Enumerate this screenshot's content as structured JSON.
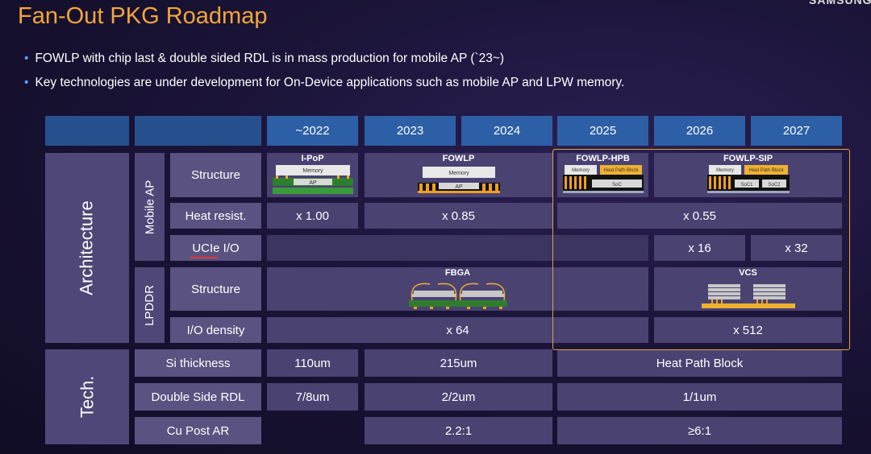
{
  "title": "Fan-Out PKG Roadmap",
  "brand": "SAMSUNG",
  "bullets": [
    "FOWLP with chip last & double sided RDL is in mass production for mobile AP (`23~)",
    "Key technologies are under development for On-Device applications such as mobile AP and LPW memory."
  ],
  "years": [
    "~2022",
    "2023",
    "2024",
    "2025",
    "2026",
    "2027"
  ],
  "groups": {
    "architecture": "Architecture",
    "tech": "Tech.",
    "mobile_ap": "Mobile AP",
    "lpddr": "LPDDR"
  },
  "rows": {
    "structure": "Structure",
    "heat_resist": "Heat resist.",
    "ucie_io": "UCIe I/O",
    "lp_structure": "Structure",
    "io_density": "I/O density",
    "si_thickness": "Si thickness",
    "double_side_rdl": "Double Side RDL",
    "cu_post_ar": "Cu Post AR"
  },
  "packages": {
    "ipop": {
      "name": "I-PoP",
      "top": "Memory",
      "chip": "AP"
    },
    "fowlp": {
      "name": "FOWLP",
      "top": "Memory",
      "chip": "AP"
    },
    "fowlp_hpb": {
      "name": "FOWLP-HPB",
      "top": "Memory",
      "block": "Heat Path Block",
      "chip": "SoC"
    },
    "fowlp_sip": {
      "name": "FOWLP-SIP",
      "top": "Memory",
      "block": "Heat Path Block",
      "chip1": "SoC1",
      "chip2": "SoC2"
    },
    "fbga": {
      "name": "FBGA"
    },
    "vcs": {
      "name": "VCS"
    }
  },
  "values": {
    "heat_2022": "x 1.00",
    "heat_2023": "x 0.85",
    "heat_2025": "x 0.55",
    "ucie_2026": "x 16",
    "ucie_2027": "x 32",
    "io_2022": "x 64",
    "io_2026": "x 512",
    "si_2022": "110um",
    "si_2023": "215um",
    "si_2025": "Heat Path Block",
    "rdl_2022": "7/8um",
    "rdl_2023": "2/2um",
    "rdl_2025": "1/1um",
    "cu_2023": "2.2:1",
    "cu_2025": "≥6:1"
  },
  "colors": {
    "title": "#f4a53a",
    "header": "#2c5fa6",
    "cell": "#4a4271",
    "highlight": "#e6a23c",
    "bullet": "#4aa3ff"
  }
}
